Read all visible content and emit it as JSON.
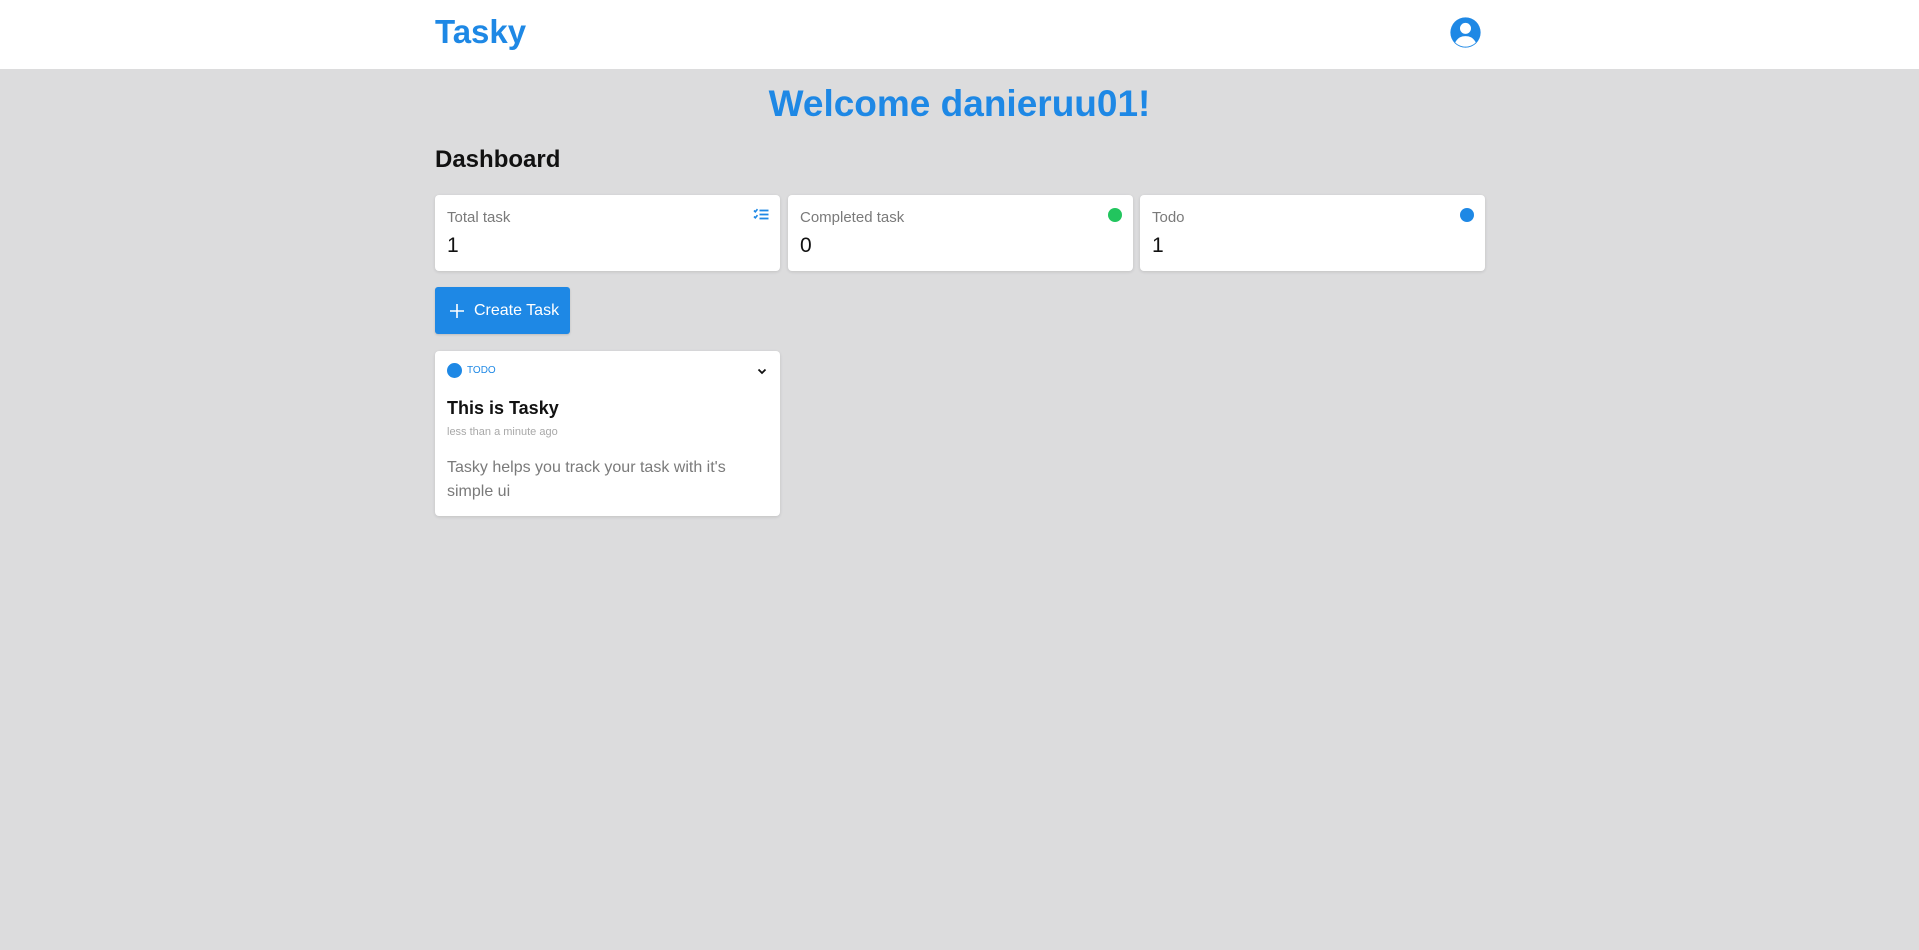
{
  "header": {
    "brand": "Tasky",
    "avatar_icon": "account-circle-icon"
  },
  "welcome": "Welcome danieruu01!",
  "dashboard": {
    "title": "Dashboard",
    "stats": [
      {
        "label": "Total task",
        "value": "1",
        "icon": "checklist-icon",
        "color": "#1e88e5"
      },
      {
        "label": "Completed task",
        "value": "0",
        "icon": "status-dot",
        "color": "#22c55e"
      },
      {
        "label": "Todo",
        "value": "1",
        "icon": "status-dot",
        "color": "#1e88e5"
      }
    ]
  },
  "actions": {
    "create_label": "Create Task",
    "create_icon": "plus-icon"
  },
  "tasks": [
    {
      "status": "TODO",
      "status_color": "#1e88e5",
      "title": "This is Tasky",
      "time": "less than a minute ago",
      "description": "Tasky helps you track your task with it's simple ui"
    }
  ],
  "colors": {
    "accent": "#1e88e5",
    "completed": "#22c55e",
    "background": "#dcdcdd"
  }
}
